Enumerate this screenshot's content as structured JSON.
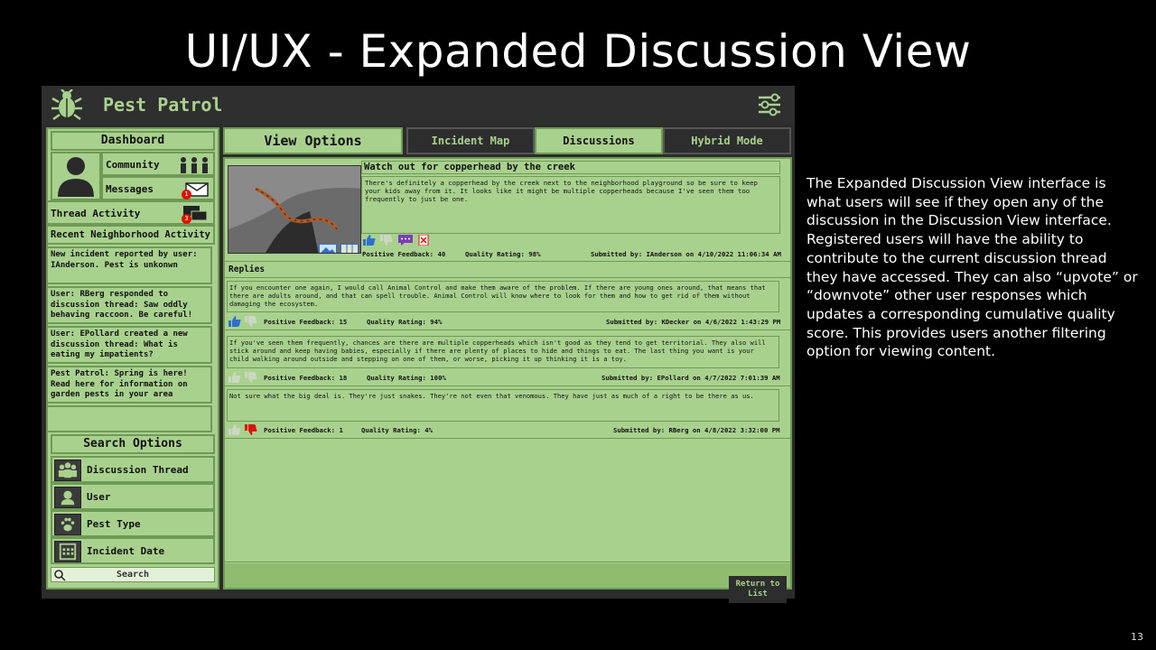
{
  "slide": {
    "title": "UI/UX - Expanded Discussion View",
    "description": "The Expanded Discussion View interface is what users will see if they open any of the discussion in the Discussion View interface. Registered users will have the ability to contribute to the current discussion thread they have accessed.  They can also “upvote” or “downvote” other user responses which updates a corresponding cumulative quality score.  This provides users another filtering option for viewing content.",
    "page_number": "13"
  },
  "app": {
    "name": "Pest Patrol",
    "icons": {
      "logo": "bug-icon",
      "settings": "sliders-icon"
    }
  },
  "sidebar": {
    "dashboard": "Dashboard",
    "community": "Community",
    "messages": "Messages",
    "messages_badge": "1",
    "thread_activity": "Thread Activity",
    "thread_badge": "3",
    "recent_heading": "Recent Neighborhood Activity",
    "news": [
      "New incident reported by user: IAnderson.  Pest is unkonwn",
      "User: RBerg responded to discussion thread: Saw oddly behaving raccoon.  Be careful!",
      "User: EPollard created a new discussion thread: What is eating my impatients?",
      "Pest Patrol:  Spring is here! Read here for information on garden pests in your area"
    ],
    "search_options": "Search Options",
    "search_items": [
      "Discussion Thread",
      "User",
      "Pest Type",
      "Incident Date"
    ],
    "search_placeholder": "Search"
  },
  "view": {
    "label": "View Options",
    "tabs": [
      "Incident Map",
      "Discussions",
      "Hybrid Mode"
    ],
    "active_tab": "Discussions"
  },
  "post": {
    "title": "Watch out for copperhead by the creek",
    "body": "There's definitely a copperhead by the creek next to the neighborhood playground so be sure to keep your kids away from it.  It looks like it might be multiple copperheads because I've seen them too frequently to just be one.",
    "feedback": "Positive Feedback: 40",
    "quality": "Quality Rating: 98%",
    "submitted": "Submitted by: IAnderson on 4/10/2022 11:06:34 AM"
  },
  "replies_label": "Replies",
  "replies": [
    {
      "body": "If you encounter one again, I would call Animal Control and make them aware of the problem. If there are young ones around, that means that there are adults around, and that can spell trouble. Animal Control will know where to look for them and how to get rid of them without damaging the ecosystem.",
      "feedback": "Positive Feedback: 15",
      "quality": "Quality Rating: 94%",
      "submitted": "Submitted by: KDecker on 4/6/2022 1:43:29 PM"
    },
    {
      "body": "If you've seen them frequently, chances are there are multiple copperheads which isn't good as they tend to get territorial.  They also will stick around and keep having babies, especially if there are plenty of places to hide and things to eat.  The last thing you want is your child walking around outside and stepping on one of them, or worse, picking it up thinking it is a toy.",
      "feedback": "Positive Feedback: 18",
      "quality": "Quality Rating: 100%",
      "submitted": "Submitted by: EPollard on 4/7/2022 7:01:39 AM"
    },
    {
      "body": "Not sure what the big deal is.  They're just snakes.  They're not even that venomous.  They have just as much of a right to be there as us.",
      "feedback": "Positive Feedback: 1",
      "quality": "Quality Rating: 4%",
      "submitted": "Submitted by: RBerg on 4/8/2022 3:32:00 PM"
    }
  ],
  "return_button": "Return to List",
  "colors": {
    "panel": "#a9d18e",
    "border": "#6e9a55",
    "dark": "#2d2d2d",
    "upvote": "#2f6fd1",
    "downvote": "#d11",
    "comment": "#7a3db8"
  }
}
